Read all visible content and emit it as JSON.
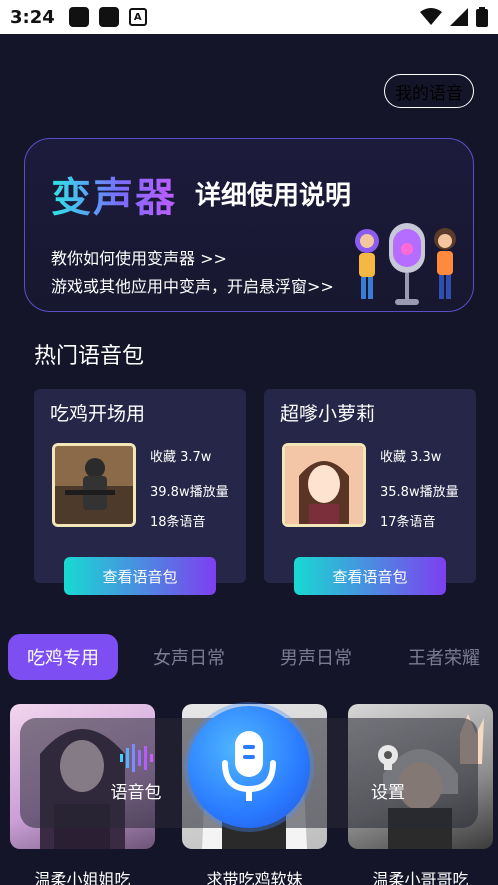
{
  "status_bar": {
    "time": "3:24"
  },
  "header": {
    "my_voice_label": "我的语音"
  },
  "banner": {
    "logo": "变声器",
    "title": "详细使用说明",
    "line1": "教你如何使用变声器 >>",
    "line2": "游戏或其他应用中变声，开启悬浮窗>>"
  },
  "section": {
    "title": "热门语音包"
  },
  "packs": [
    {
      "name": "吃鸡开场用",
      "favorites": "收藏 3.7w",
      "plays": "39.8w播放量",
      "count": "18条语音",
      "button": "查看语音包"
    },
    {
      "name": "超嗲小萝莉",
      "favorites": "收藏 3.3w",
      "plays": "35.8w播放量",
      "count": "17条语音",
      "button": "查看语音包"
    }
  ],
  "tabs": [
    "吃鸡专用",
    "女声日常",
    "男声日常",
    "王者荣耀"
  ],
  "voices": [
    "温柔小姐姐吃",
    "求带吃鸡软妹",
    "温柔小哥哥吃"
  ],
  "bottom_bar": {
    "voice_pack": "语音包",
    "settings": "设置"
  },
  "colors": {
    "accent": "#7d4ff2",
    "background": "#15152a",
    "card": "#262649",
    "button_gradient_start": "#18dad2",
    "button_gradient_end": "#7d3ff0"
  }
}
